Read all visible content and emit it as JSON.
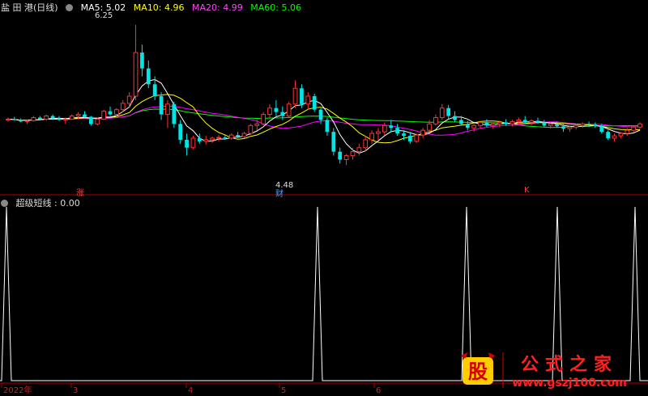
{
  "header": {
    "title": "盐 田 港(日线)",
    "ma5": "MA5: 5.02",
    "ma10": "MA10: 4.96",
    "ma20": "MA20: 4.99",
    "ma60": "MA60: 5.06"
  },
  "indicator": {
    "label": "超级短线 : 0.00"
  },
  "annotations": {
    "high": "6.25",
    "low": "4.48",
    "tag_zhang": "涨",
    "tag_cai": "财",
    "tag_k": "K"
  },
  "xaxis": {
    "labels": [
      "2022年",
      "3",
      "4",
      "5",
      "6"
    ]
  },
  "watermark": {
    "logo_char": "股",
    "text": "公式之家",
    "url": "www.gszj100.com"
  },
  "colors": {
    "up": "#ff3232",
    "down": "#00e5e5",
    "ma5": "#ffffff",
    "ma10": "#ffff00",
    "ma20": "#ff00ff",
    "ma60": "#00ff00",
    "axis": "#b00000"
  },
  "chart_data": [
    {
      "type": "candlestick",
      "title": "盐 田 港(日线)",
      "ylim": [
        4.3,
        6.4
      ],
      "grid": false,
      "legend": "top-left",
      "series_note": "MA5/MA10/MA20/MA60 overlays",
      "candles": [
        [
          5.05,
          5.08,
          5.03,
          5.06
        ],
        [
          5.06,
          5.09,
          5.04,
          5.05
        ],
        [
          5.05,
          5.07,
          5.02,
          5.03
        ],
        [
          5.03,
          5.05,
          5.0,
          5.04
        ],
        [
          5.04,
          5.1,
          5.03,
          5.08
        ],
        [
          5.08,
          5.1,
          5.05,
          5.06
        ],
        [
          5.06,
          5.12,
          5.04,
          5.1
        ],
        [
          5.1,
          5.12,
          5.05,
          5.07
        ],
        [
          5.07,
          5.1,
          5.04,
          5.05
        ],
        [
          5.05,
          5.08,
          5.0,
          5.06
        ],
        [
          5.06,
          5.12,
          5.05,
          5.1
        ],
        [
          5.1,
          5.15,
          5.06,
          5.12
        ],
        [
          5.12,
          5.16,
          5.08,
          5.09
        ],
        [
          5.09,
          5.1,
          4.98,
          5.0
        ],
        [
          5.0,
          5.08,
          4.98,
          5.06
        ],
        [
          5.06,
          5.18,
          5.05,
          5.16
        ],
        [
          5.16,
          5.22,
          5.1,
          5.12
        ],
        [
          5.12,
          5.2,
          5.08,
          5.18
        ],
        [
          5.18,
          5.3,
          5.15,
          5.26
        ],
        [
          5.26,
          5.4,
          5.2,
          5.35
        ],
        [
          5.35,
          6.25,
          5.3,
          5.9
        ],
        [
          5.9,
          6.0,
          5.6,
          5.7
        ],
        [
          5.7,
          5.8,
          5.45,
          5.5
        ],
        [
          5.5,
          5.6,
          5.3,
          5.35
        ],
        [
          5.35,
          5.4,
          5.05,
          5.12
        ],
        [
          5.12,
          5.3,
          4.95,
          5.25
        ],
        [
          5.25,
          5.28,
          4.95,
          5.0
        ],
        [
          5.0,
          5.05,
          4.75,
          4.8
        ],
        [
          4.8,
          4.88,
          4.6,
          4.7
        ],
        [
          4.7,
          4.85,
          4.68,
          4.82
        ],
        [
          4.82,
          4.88,
          4.75,
          4.78
        ],
        [
          4.78,
          4.85,
          4.74,
          4.8
        ],
        [
          4.8,
          4.84,
          4.76,
          4.82
        ],
        [
          4.82,
          4.86,
          4.78,
          4.83
        ],
        [
          4.83,
          4.86,
          4.8,
          4.82
        ],
        [
          4.82,
          4.88,
          4.8,
          4.86
        ],
        [
          4.86,
          4.9,
          4.82,
          4.84
        ],
        [
          4.84,
          4.9,
          4.82,
          4.88
        ],
        [
          4.88,
          5.0,
          4.86,
          4.98
        ],
        [
          4.98,
          5.05,
          4.92,
          5.0
        ],
        [
          5.0,
          5.15,
          4.98,
          5.12
        ],
        [
          5.12,
          5.25,
          5.08,
          5.2
        ],
        [
          5.2,
          5.3,
          5.1,
          5.15
        ],
        [
          5.15,
          5.22,
          5.05,
          5.1
        ],
        [
          5.1,
          5.28,
          5.08,
          5.25
        ],
        [
          5.25,
          5.55,
          5.2,
          5.45
        ],
        [
          5.45,
          5.5,
          5.2,
          5.25
        ],
        [
          5.25,
          5.4,
          5.18,
          5.35
        ],
        [
          5.35,
          5.38,
          5.15,
          5.18
        ],
        [
          5.18,
          5.2,
          5.0,
          5.05
        ],
        [
          5.05,
          5.08,
          4.85,
          4.9
        ],
        [
          4.9,
          4.95,
          4.6,
          4.65
        ],
        [
          4.65,
          4.7,
          4.5,
          4.55
        ],
        [
          4.55,
          4.62,
          4.48,
          4.6
        ],
        [
          4.6,
          4.7,
          4.55,
          4.65
        ],
        [
          4.65,
          4.75,
          4.6,
          4.7
        ],
        [
          4.7,
          4.85,
          4.66,
          4.8
        ],
        [
          4.8,
          4.92,
          4.75,
          4.88
        ],
        [
          4.88,
          4.95,
          4.8,
          4.9
        ],
        [
          4.9,
          5.02,
          4.86,
          4.98
        ],
        [
          4.98,
          5.05,
          4.9,
          4.95
        ],
        [
          4.95,
          5.0,
          4.85,
          4.88
        ],
        [
          4.88,
          4.92,
          4.8,
          4.85
        ],
        [
          4.85,
          4.9,
          4.75,
          4.78
        ],
        [
          4.78,
          4.88,
          4.76,
          4.86
        ],
        [
          4.86,
          4.95,
          4.82,
          4.92
        ],
        [
          4.92,
          5.05,
          4.9,
          5.0
        ],
        [
          5.0,
          5.12,
          4.98,
          5.08
        ],
        [
          5.08,
          5.25,
          5.05,
          5.2
        ],
        [
          5.2,
          5.24,
          5.06,
          5.1
        ],
        [
          5.1,
          5.16,
          5.02,
          5.05
        ],
        [
          5.05,
          5.1,
          4.98,
          5.0
        ],
        [
          5.0,
          5.04,
          4.92,
          4.95
        ],
        [
          4.95,
          5.0,
          4.9,
          4.98
        ],
        [
          4.98,
          5.04,
          4.94,
          5.02
        ],
        [
          5.02,
          5.06,
          4.96,
          4.98
        ],
        [
          4.98,
          5.02,
          4.94,
          5.0
        ],
        [
          5.0,
          5.04,
          4.96,
          5.02
        ],
        [
          5.02,
          5.06,
          4.98,
          5.0
        ],
        [
          5.0,
          5.05,
          4.97,
          5.03
        ],
        [
          5.03,
          5.08,
          5.0,
          5.05
        ],
        [
          5.05,
          5.1,
          5.0,
          5.02
        ],
        [
          5.02,
          5.06,
          4.98,
          5.04
        ],
        [
          5.04,
          5.08,
          5.0,
          5.02
        ],
        [
          5.02,
          5.05,
          4.96,
          4.98
        ],
        [
          4.98,
          5.02,
          4.94,
          5.0
        ],
        [
          5.0,
          5.03,
          4.95,
          4.97
        ],
        [
          4.97,
          5.0,
          4.9,
          4.94
        ],
        [
          4.94,
          4.98,
          4.9,
          4.96
        ],
        [
          4.96,
          5.0,
          4.93,
          4.98
        ],
        [
          4.98,
          5.02,
          4.95,
          5.0
        ],
        [
          5.0,
          5.03,
          4.96,
          4.99
        ],
        [
          4.99,
          5.02,
          4.95,
          4.97
        ],
        [
          4.97,
          5.0,
          4.88,
          4.9
        ],
        [
          4.9,
          4.92,
          4.8,
          4.82
        ],
        [
          4.82,
          4.88,
          4.78,
          4.85
        ],
        [
          4.85,
          4.9,
          4.82,
          4.88
        ],
        [
          4.88,
          4.95,
          4.85,
          4.92
        ],
        [
          4.92,
          4.98,
          4.9,
          4.96
        ],
        [
          4.96,
          5.02,
          4.94,
          5.0
        ]
      ]
    },
    {
      "type": "line",
      "title": "超级短线 : 0.00",
      "ylim": [
        0,
        100
      ],
      "x": [
        "2022年",
        "3",
        "4",
        "5",
        "6"
      ],
      "spikes_at_fraction": [
        0.01,
        0.49,
        0.72,
        0.86,
        0.98
      ],
      "baseline": 0,
      "peak": 100
    }
  ]
}
